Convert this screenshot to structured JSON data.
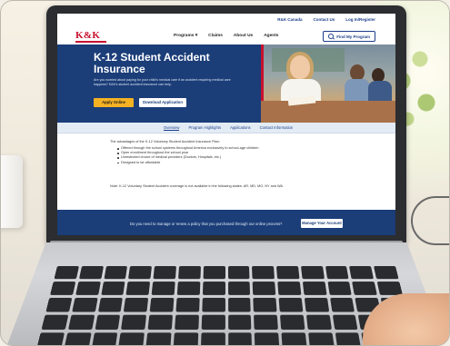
{
  "site": {
    "top_links": [
      "R&K Canada",
      "Contact Us",
      "Log In/Register"
    ],
    "logo": "K&K",
    "nav": [
      "Programs",
      "Claims",
      "About Us",
      "Agents"
    ],
    "find_program": "Find My Program"
  },
  "hero": {
    "title": "K-12 Student Accident Insurance",
    "description": "Are you worried about paying for your child's medical care if an accident requiring medical care happens? K&K's student accident insurance can help.",
    "apply_label": "Apply Online",
    "download_label": "Download Application"
  },
  "tabs": [
    {
      "label": "Overview",
      "active": true
    },
    {
      "label": "Program Highlights",
      "active": false
    },
    {
      "label": "Applications",
      "active": false
    },
    {
      "label": "Contact Information",
      "active": false
    }
  ],
  "content": {
    "intro": "The advantages of the K-12 Voluntary Student Accident Insurance Plan:",
    "bullets": [
      "Offered through the school systems throughout America exclusively to school-age children",
      "Open enrollment throughout the school year",
      "Unrestricted choice of medical providers (Doctors, Hospitals, etc.)",
      "Designed to be affordable"
    ],
    "note": "Note: K-12 Voluntary Student Accident coverage is not available in the following states: AR, MD, MO, NY and WA."
  },
  "banner": {
    "text": "Do you need to manage or renew a policy that you purchased through our online process?",
    "button_label": "Manage Your Account"
  },
  "colors": {
    "navy": "#1b3d78",
    "brand_red": "#c8102e",
    "apply_yellow": "#f4b223"
  }
}
